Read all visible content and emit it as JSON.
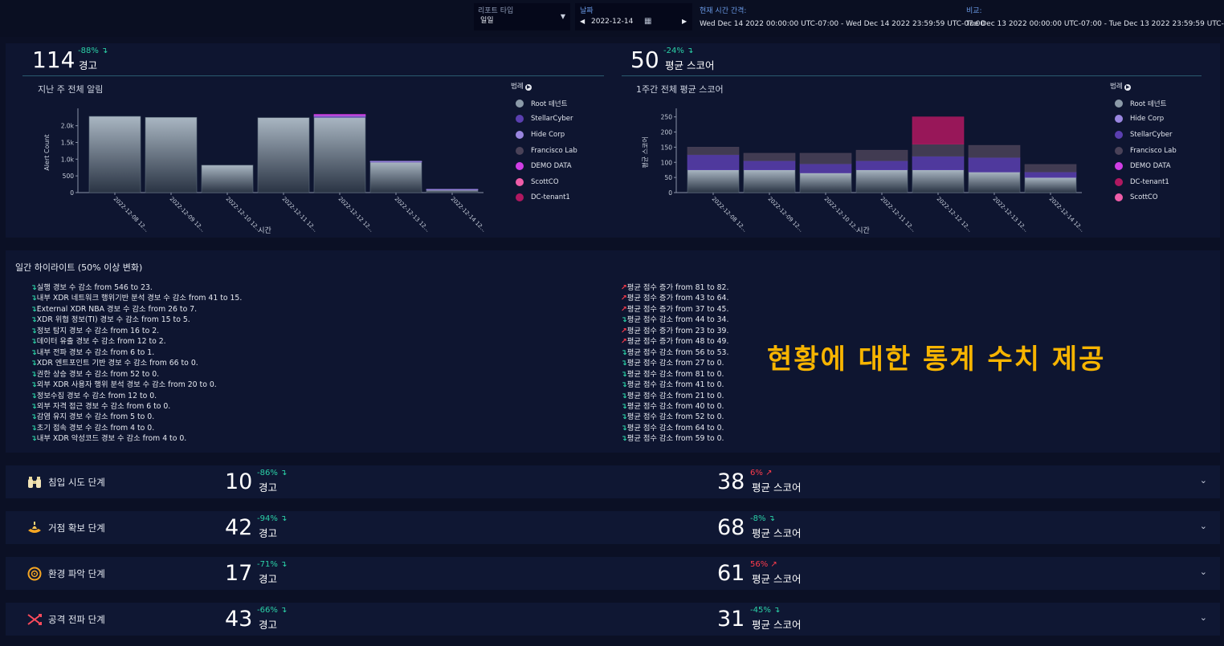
{
  "topbar": {
    "report_type_label": "리포트 타입",
    "report_type_value": "일일",
    "date_label": "날짜",
    "date_value": "2022-12-14",
    "current_interval_label": "현재 시간 간격:",
    "current_interval_value": "Wed Dec 14 2022 00:00:00 UTC-07:00 - Wed Dec 14 2022 23:59:59 UTC-07:00",
    "compare_label": "비교:",
    "compare_value": "Tue Dec 13 2022 00:00:00 UTC-07:00 - Tue Dec 13 2022 23:59:59 UTC-07:00"
  },
  "summary": {
    "alerts": {
      "value": "114",
      "pct": "-88%",
      "label": "경고"
    },
    "score": {
      "value": "50",
      "pct": "-24%",
      "label": "평균 스코어"
    }
  },
  "colors": {
    "up": "#ff3c4c",
    "down": "#2bd2a8",
    "accent": "#f7b400",
    "Root 테넌트": "#8b9aa8",
    "StellarCyber": "#5b3fb0",
    "Hide Corp": "#9a86e0",
    "Francisco Lab": "#4a4258",
    "DEMO DATA": "#d13ee6",
    "ScottCO": "#ef5da8",
    "DC-tenant1": "#b01860"
  },
  "legend_title": "범례",
  "chart_data": [
    {
      "type": "bar",
      "title": "지난 주 전체 알림",
      "xlabel": "시간",
      "ylabel": "Alert Count",
      "ylim": [
        0,
        2400
      ],
      "yticks": [
        "0",
        "500",
        "1.0k",
        "1.5k",
        "2.0k"
      ],
      "categories": [
        "2022-12-08 12...",
        "2022-12-09 12...",
        "2022-12-10 12...",
        "2022-12-11 12...",
        "2022-12-12 12...",
        "2022-12-13 12...",
        "2022-12-14 12..."
      ],
      "series": [
        {
          "name": "Root 테넌트",
          "values": [
            2280,
            2250,
            820,
            2240,
            2250,
            920,
            90
          ]
        },
        {
          "name": "StellarCyber",
          "values": [
            0,
            0,
            0,
            0,
            30,
            10,
            5
          ]
        },
        {
          "name": "Hide Corp",
          "values": [
            0,
            0,
            0,
            0,
            20,
            10,
            5
          ]
        },
        {
          "name": "Francisco Lab",
          "values": [
            0,
            0,
            0,
            0,
            0,
            0,
            0
          ]
        },
        {
          "name": "DEMO DATA",
          "values": [
            0,
            0,
            0,
            0,
            40,
            0,
            0
          ]
        },
        {
          "name": "ScottCO",
          "values": [
            0,
            0,
            0,
            0,
            0,
            0,
            0
          ]
        },
        {
          "name": "DC-tenant1",
          "values": [
            0,
            0,
            0,
            0,
            0,
            0,
            0
          ]
        }
      ],
      "legend_position": "right"
    },
    {
      "type": "bar",
      "title": "1주간 전체 평균 스코어",
      "xlabel": "시간",
      "ylabel": "평균 스코어",
      "ylim": [
        0,
        265
      ],
      "yticks": [
        "0",
        "50",
        "100",
        "150",
        "200",
        "250"
      ],
      "categories": [
        "2022-12-08 12...",
        "2022-12-09 12...",
        "2022-12-10 12...",
        "2022-12-11 12...",
        "2022-12-12 12...",
        "2022-12-13 12...",
        "2022-12-14 12..."
      ],
      "series": [
        {
          "name": "Root 테넌트",
          "values": [
            75,
            75,
            65,
            75,
            75,
            68,
            50
          ]
        },
        {
          "name": "Hide Corp",
          "values": [
            0,
            0,
            0,
            0,
            0,
            0,
            0
          ]
        },
        {
          "name": "StellarCyber",
          "values": [
            50,
            30,
            30,
            30,
            45,
            48,
            18
          ]
        },
        {
          "name": "Francisco Lab",
          "values": [
            25,
            25,
            35,
            35,
            40,
            40,
            25
          ]
        },
        {
          "name": "DEMO DATA",
          "values": [
            0,
            0,
            0,
            0,
            0,
            0,
            0
          ]
        },
        {
          "name": "DC-tenant1",
          "values": [
            0,
            0,
            0,
            0,
            90,
            0,
            0
          ]
        },
        {
          "name": "ScottCO",
          "values": [
            0,
            0,
            0,
            0,
            0,
            0,
            0
          ]
        }
      ],
      "legend_position": "right"
    }
  ],
  "highlights": {
    "title": "일간 하이라이트 (50% 이상 변화)",
    "left": [
      {
        "dir": "down",
        "text": "실행 경보 수 감소 from 546 to 23."
      },
      {
        "dir": "down",
        "text": "내부 XDR 네트워크 행위기반 분석 경보 수 감소 from 41 to 15."
      },
      {
        "dir": "down",
        "text": "External XDR NBA 경보 수 감소 from 26 to 7."
      },
      {
        "dir": "down",
        "text": "XDR 위협 정보(TI) 경보 수 감소 from 15 to 5."
      },
      {
        "dir": "down",
        "text": "정보 탐지 경보 수 감소 from 16 to 2."
      },
      {
        "dir": "down",
        "text": "데이터 유출 경보 수 감소 from 12 to 2."
      },
      {
        "dir": "down",
        "text": "내부 전파 경보 수 감소 from 6 to 1."
      },
      {
        "dir": "down",
        "text": "XDR 엔트포인트 기반 경보 수 감소 from 66 to 0."
      },
      {
        "dir": "down",
        "text": "권한 상승 경보 수 감소 from 52 to 0."
      },
      {
        "dir": "down",
        "text": "외부 XDR 사용자 행위 분석 경보 수 감소 from 20 to 0."
      },
      {
        "dir": "down",
        "text": "정보수집 경보 수 감소 from 12 to 0."
      },
      {
        "dir": "down",
        "text": "외부 자격 접근 경보 수 감소 from 6 to 0."
      },
      {
        "dir": "down",
        "text": "감염 유지 경보 수 감소 from 5 to 0."
      },
      {
        "dir": "down",
        "text": "초기 접속 경보 수 감소 from 4 to 0."
      },
      {
        "dir": "down",
        "text": "내부 XDR 악성코드 경보 수 감소 from 4 to 0."
      }
    ],
    "right": [
      {
        "dir": "up",
        "text": "평균 점수 증가 from 81 to 82."
      },
      {
        "dir": "up",
        "text": "평균 점수 증가 from 43 to 64."
      },
      {
        "dir": "up",
        "text": "평균 점수 증가 from 37 to 45."
      },
      {
        "dir": "down",
        "text": "평균 점수 감소 from 44 to 34."
      },
      {
        "dir": "up",
        "text": "평균 점수 증가 from 23 to 39."
      },
      {
        "dir": "up",
        "text": "평균 점수 증가 from 48 to 49."
      },
      {
        "dir": "down",
        "text": "평균 점수 감소 from 56 to 53."
      },
      {
        "dir": "down",
        "text": "평균 점수 감소 from 27 to 0."
      },
      {
        "dir": "down",
        "text": "평균 점수 감소 from 81 to 0."
      },
      {
        "dir": "down",
        "text": "평균 점수 감소 from 41 to 0."
      },
      {
        "dir": "down",
        "text": "평균 점수 감소 from 21 to 0."
      },
      {
        "dir": "down",
        "text": "평균 점수 감소 from 40 to 0."
      },
      {
        "dir": "down",
        "text": "평균 점수 감소 from 52 to 0."
      },
      {
        "dir": "down",
        "text": "평균 점수 감소 from 64 to 0."
      },
      {
        "dir": "down",
        "text": "평균 점수 감소 from 59 to 0."
      }
    ]
  },
  "overlay_text": "현황에 대한 통계 수치 제공",
  "phases": [
    {
      "icon": "binoculars-icon",
      "name": "침입 시도 단계",
      "alerts": "10",
      "alerts_pct": "-86%",
      "alerts_dir": "down",
      "alerts_label": "경고",
      "score": "38",
      "score_pct": "6%",
      "score_dir": "up",
      "score_label": "평균 스코어"
    },
    {
      "icon": "lamp-icon",
      "name": "거점 확보 단계",
      "alerts": "42",
      "alerts_pct": "-94%",
      "alerts_dir": "down",
      "alerts_label": "경고",
      "score": "68",
      "score_pct": "-8%",
      "score_dir": "down",
      "score_label": "평균 스코어"
    },
    {
      "icon": "target-ring-icon",
      "name": "환경 파악 단계",
      "alerts": "17",
      "alerts_pct": "-71%",
      "alerts_dir": "down",
      "alerts_label": "경고",
      "score": "61",
      "score_pct": "56%",
      "score_dir": "up",
      "score_label": "평균 스코어"
    },
    {
      "icon": "cross-arrows-icon",
      "name": "공격 전파 단계",
      "alerts": "43",
      "alerts_pct": "-66%",
      "alerts_dir": "down",
      "alerts_label": "경고",
      "score": "31",
      "score_pct": "-45%",
      "score_dir": "down",
      "score_label": "평균 스코어"
    }
  ]
}
